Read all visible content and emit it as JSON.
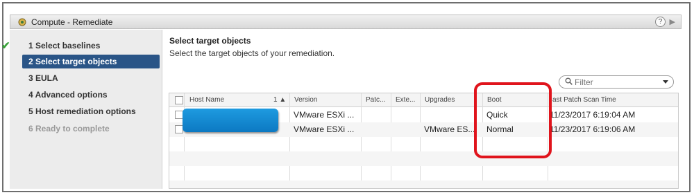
{
  "window": {
    "title": "Compute - Remediate",
    "help_label": "?",
    "next_label": "▶"
  },
  "wizard": {
    "steps": [
      {
        "label": "1  Select baselines",
        "state": "completed"
      },
      {
        "label": "2  Select target objects",
        "state": "active"
      },
      {
        "label": "3  EULA",
        "state": "pending"
      },
      {
        "label": "4  Advanced options",
        "state": "pending"
      },
      {
        "label": "5  Host remediation options",
        "state": "pending"
      },
      {
        "label": "6  Ready to complete",
        "state": "disabled"
      }
    ],
    "check_glyph": "✔"
  },
  "main": {
    "heading": "Select target objects",
    "description": "Select the target objects of your remediation.",
    "filter": {
      "placeholder": "Filter",
      "value": ""
    }
  },
  "table": {
    "columns": [
      {
        "key": "host",
        "label": "Host Name"
      },
      {
        "key": "sort",
        "label": "1 ▲"
      },
      {
        "key": "version",
        "label": "Version"
      },
      {
        "key": "patch",
        "label": "Patc..."
      },
      {
        "key": "ext",
        "label": "Exte..."
      },
      {
        "key": "upgrades",
        "label": "Upgrades"
      },
      {
        "key": "boot",
        "label": "Boot"
      },
      {
        "key": "last_scan",
        "label": "ast Patch Scan Time"
      }
    ],
    "rows": [
      {
        "host": "",
        "version": "VMware ESXi ...",
        "patch": "",
        "ext": "",
        "upgrades": "",
        "boot": "Quick",
        "last_scan": "11/23/2017 6:19:04 AM"
      },
      {
        "host": "",
        "version": "VMware ESXi ...",
        "patch": "",
        "ext": "",
        "upgrades": "VMware ES...",
        "boot": "Normal",
        "last_scan": "11/23/2017 6:19:06 AM"
      }
    ]
  },
  "colors": {
    "active_step": "#2a5587",
    "highlight": "#e0141c",
    "redaction": "#0c79c2",
    "check": "#3aa13a"
  }
}
